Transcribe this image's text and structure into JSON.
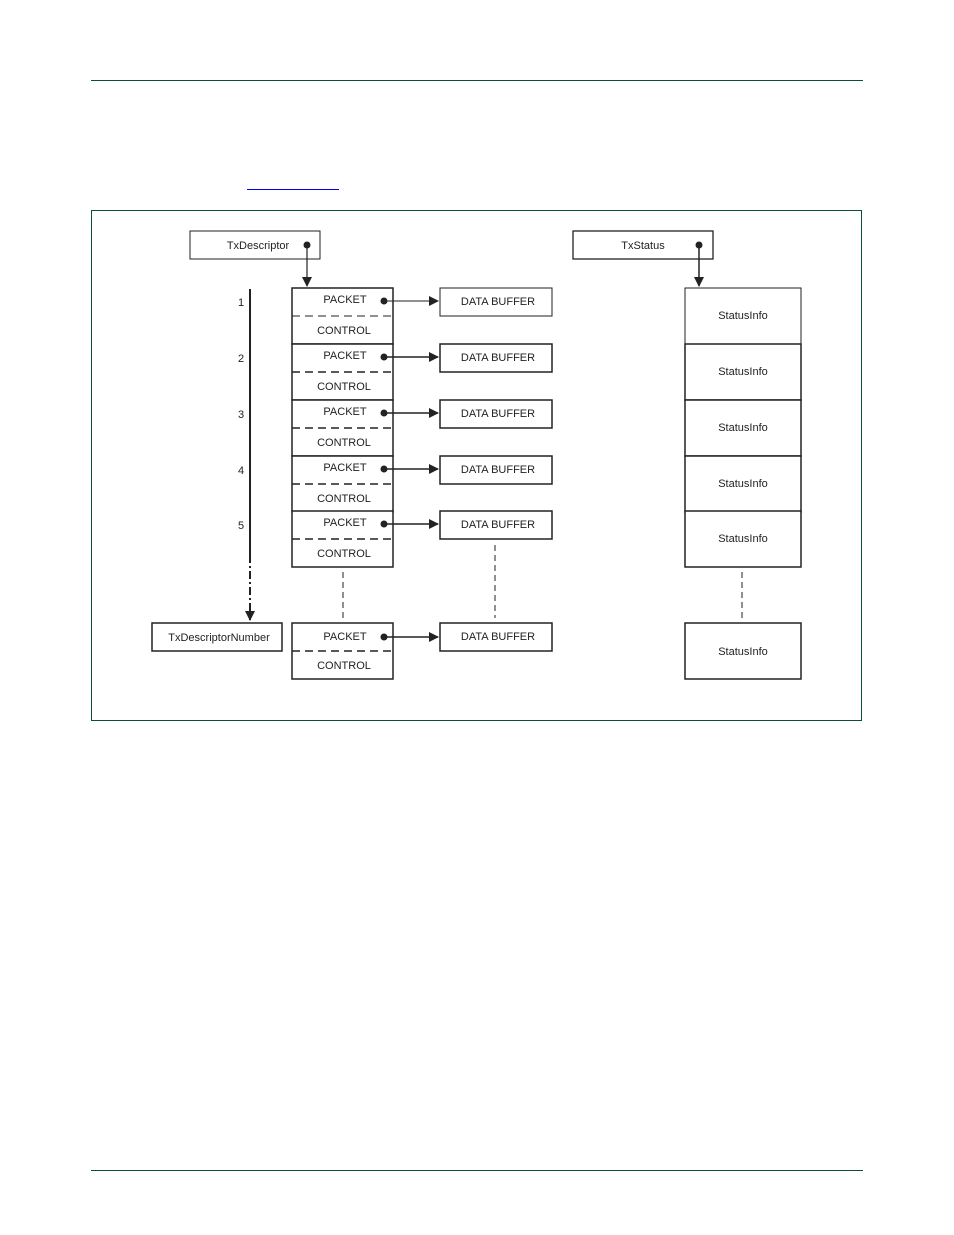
{
  "page": {
    "link_text": ""
  },
  "diagram": {
    "tx_descriptor_label": "TxDescriptor",
    "tx_status_label": "TxStatus",
    "tx_descriptor_number_label": "TxDescriptorNumber",
    "packet_label": "PACKET",
    "control_label": "CONTROL",
    "data_buffer_label": "DATA BUFFER",
    "status_info_label": "StatusInfo",
    "indices": [
      "1",
      "2",
      "3",
      "4",
      "5"
    ],
    "descriptors": [
      {
        "index": "1",
        "packet": "PACKET",
        "control": "CONTROL",
        "buffer": "DATA BUFFER",
        "status": "StatusInfo"
      },
      {
        "index": "2",
        "packet": "PACKET",
        "control": "CONTROL",
        "buffer": "DATA BUFFER",
        "status": "StatusInfo"
      },
      {
        "index": "3",
        "packet": "PACKET",
        "control": "CONTROL",
        "buffer": "DATA BUFFER",
        "status": "StatusInfo"
      },
      {
        "index": "4",
        "packet": "PACKET",
        "control": "CONTROL",
        "buffer": "DATA BUFFER",
        "status": "StatusInfo"
      },
      {
        "index": "5",
        "packet": "PACKET",
        "control": "CONTROL",
        "buffer": "DATA BUFFER",
        "status": "StatusInfo"
      }
    ],
    "last_descriptor": {
      "packet": "PACKET",
      "control": "CONTROL",
      "buffer": "DATA BUFFER",
      "status": "StatusInfo"
    }
  }
}
